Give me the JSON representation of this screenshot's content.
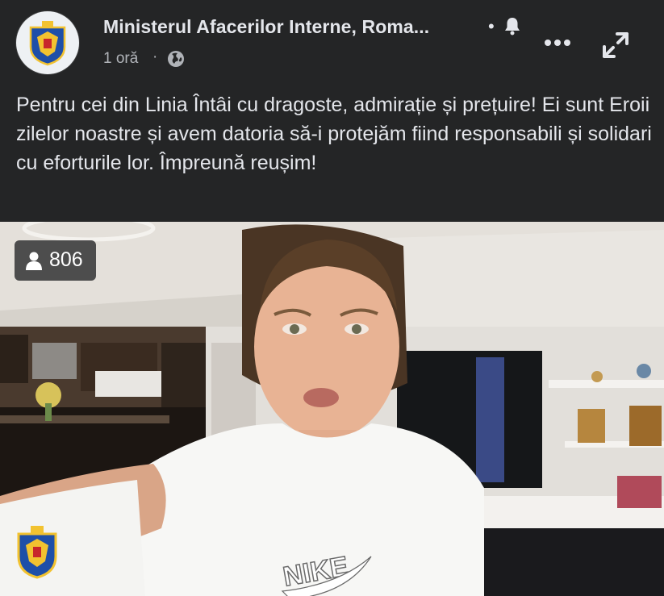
{
  "header": {
    "page_name": "Ministerul Afacerilor Interne, Roma...",
    "separator": "•",
    "time": "1 oră",
    "meta_separator": "·",
    "icons": {
      "bell": "bell-icon",
      "globe": "globe-icon",
      "more": "more-icon",
      "expand": "expand-icon"
    }
  },
  "post": {
    "text": "Pentru cei din Linia Întâi cu dragoste, admirație și prețuire! Ei sunt Eroii zilelor noastre și avem datoria să-i protejăm fiind responsabili și solidari cu eforturile lor. Împreună reușim!"
  },
  "video": {
    "viewer_count": "806",
    "viewer_icon": "person-icon",
    "shirt_logo": "NIKE"
  },
  "colors": {
    "background": "#242526",
    "primary_text": "#e4e6eb",
    "secondary_text": "#b0b3b8"
  }
}
